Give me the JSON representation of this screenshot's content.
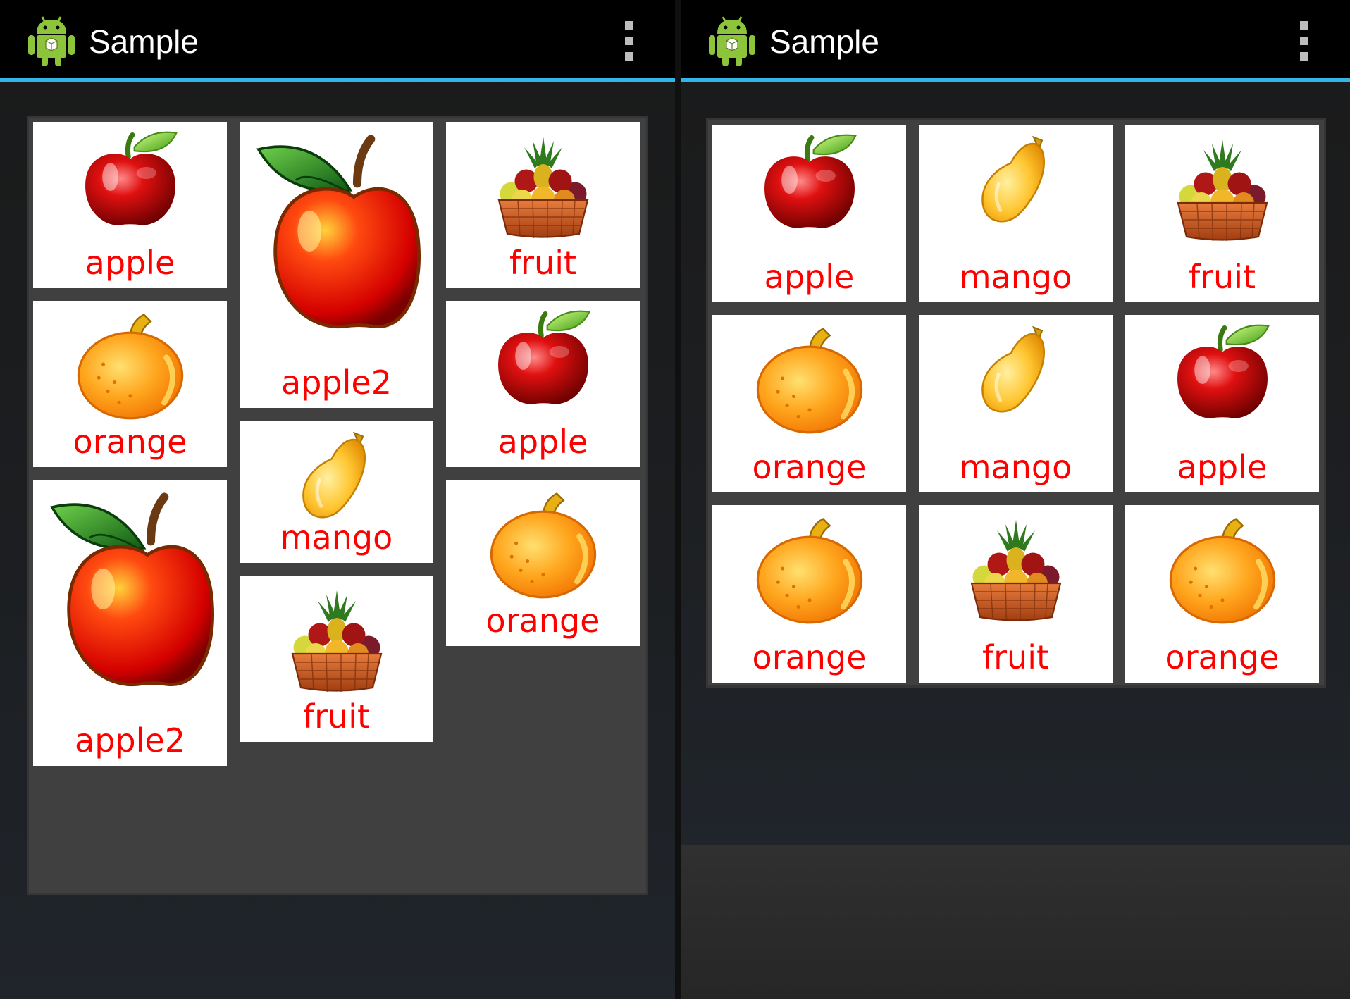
{
  "colors": {
    "accent": "#33b5e5",
    "label": "#ff0000",
    "actionbar": "#000000",
    "grid_bg": "#404040",
    "tile_bg": "#ffffff"
  },
  "app": {
    "title": "Sample",
    "launcher_icon": "android-robot-icon",
    "menu_icon": "overflow-menu-icon"
  },
  "left_screen": {
    "layout": "staggered-grid",
    "columns": [
      {
        "items": [
          {
            "label": "apple",
            "icon": "red-apple-icon"
          },
          {
            "label": "orange",
            "icon": "orange-icon"
          },
          {
            "label": "apple2",
            "icon": "big-apple-icon"
          }
        ]
      },
      {
        "items": [
          {
            "label": "apple2",
            "icon": "big-apple-icon"
          },
          {
            "label": "mango",
            "icon": "mango-icon"
          },
          {
            "label": "fruit",
            "icon": "fruit-basket-icon"
          }
        ]
      },
      {
        "items": [
          {
            "label": "fruit",
            "icon": "fruit-basket-icon"
          },
          {
            "label": "apple",
            "icon": "red-apple-icon"
          },
          {
            "label": "orange",
            "icon": "orange-icon"
          }
        ]
      }
    ]
  },
  "right_screen": {
    "layout": "uniform-grid",
    "rows": [
      [
        {
          "label": "apple",
          "icon": "red-apple-icon"
        },
        {
          "label": "mango",
          "icon": "mango-icon"
        },
        {
          "label": "fruit",
          "icon": "fruit-basket-icon"
        }
      ],
      [
        {
          "label": "orange",
          "icon": "orange-icon"
        },
        {
          "label": "mango",
          "icon": "mango-icon"
        },
        {
          "label": "apple",
          "icon": "red-apple-icon"
        }
      ],
      [
        {
          "label": "orange",
          "icon": "orange-icon"
        },
        {
          "label": "fruit",
          "icon": "fruit-basket-icon"
        },
        {
          "label": "orange",
          "icon": "orange-icon"
        }
      ]
    ]
  }
}
